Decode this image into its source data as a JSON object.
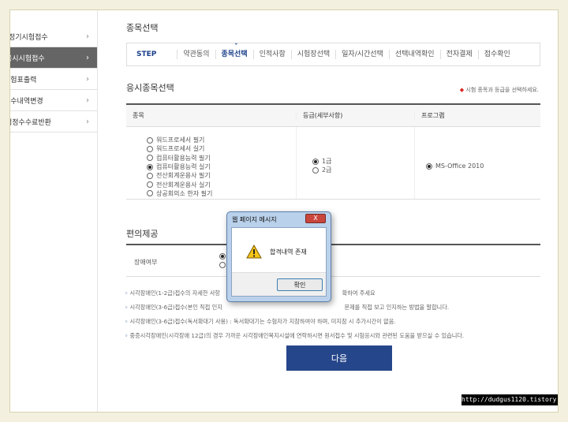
{
  "sidebar": {
    "items": [
      {
        "label": "정기시험접수",
        "active": false
      },
      {
        "label": "응시시험접수",
        "active": true
      },
      {
        "label": "수험표출력",
        "active": false
      },
      {
        "label": "접수내역변경",
        "active": false
      },
      {
        "label": "검정수수료반환",
        "active": false
      }
    ]
  },
  "page": {
    "title": "종목선택",
    "step_label": "STEP",
    "steps": [
      "약관동의",
      "종목선택",
      "인적사항",
      "시험장선택",
      "일자/시간선택",
      "선택내역확인",
      "전자결제",
      "접수확인"
    ],
    "current_step": "종목선택"
  },
  "section": {
    "title": "응시종목선택",
    "note": "시험 종목과 등급을 선택하세요."
  },
  "table": {
    "headers": [
      "종목",
      "등급(세부사항)",
      "프로그램"
    ],
    "subjects": [
      {
        "label": "워드프로세서 필기",
        "selected": false
      },
      {
        "label": "워드프로세서 실기",
        "selected": false
      },
      {
        "label": "컴퓨터활용능력 필기",
        "selected": false
      },
      {
        "label": "컴퓨터활용능력 실기",
        "selected": true
      },
      {
        "label": "전산회계운용사 필기",
        "selected": false
      },
      {
        "label": "전산회계운용사 실기",
        "selected": false
      },
      {
        "label": "상공회의소 한자 필기",
        "selected": false
      }
    ],
    "grades": [
      {
        "label": "1급",
        "selected": true
      },
      {
        "label": "2급",
        "selected": false
      }
    ],
    "programs": [
      {
        "label": "MS-Office 2010",
        "selected": true
      }
    ]
  },
  "convenience": {
    "title": "편의제공",
    "row_label": "장애여부"
  },
  "notes": [
    "시각장애인(1-2급)접수의 자세한 사항",
    "시각장애인(3-6급)접수(본인 직접 인지",
    "시각장애인(3-6급)접수(독서확대기 사용) : 독서확대기는 수험자가 지참하여야 하며, 미지참 시 추가시간이 없음.",
    "중증시각장애인(시각장애 12급)의 경우 가까운 시각장애인복지시설에 연락하시면 원서접수 및 시험응시와 관련된 도움을 받으실 수 있습니다."
  ],
  "notes_right": [
    "확하여 주세요",
    "문제를 직접 보고 인지하는 방법을 말합니다."
  ],
  "next_button": "다음",
  "watermark": "http://dudgus1120.tistory.com",
  "dialog": {
    "title": "웹 페이지 메시지",
    "close": "X",
    "message": "합격내역 존재",
    "ok": "확인"
  },
  "colors": {
    "accent": "#26468b",
    "sidebar_active": "#656565",
    "page_bg": "#f3f0df"
  }
}
